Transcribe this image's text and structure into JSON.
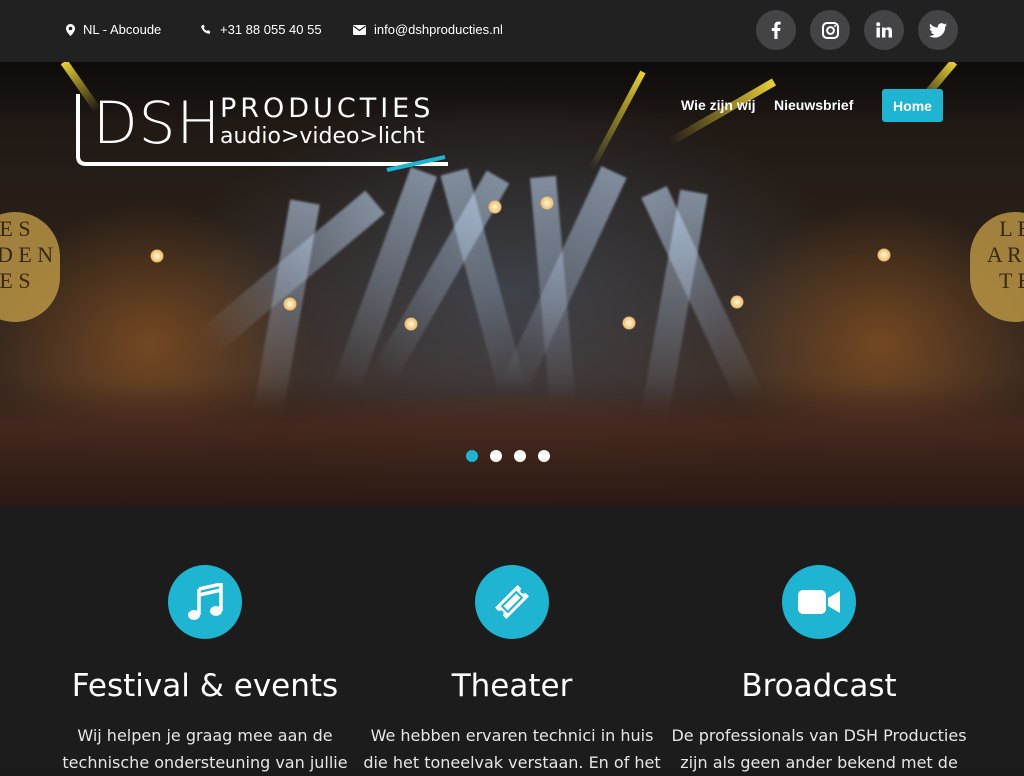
{
  "topbar": {
    "location": "NL - Abcoude",
    "phone": "+31 88 055 40 55",
    "email": "info@dshproducties.nl",
    "social": [
      "facebook-icon",
      "instagram-icon",
      "linkedin-icon",
      "twitter-icon"
    ]
  },
  "logo": {
    "main": "DSH",
    "word": "PRODUCTIES",
    "sub": "audio>video>licht"
  },
  "nav": {
    "items": [
      "Wie zijn wij",
      "Nieuwsbrief",
      "Home"
    ],
    "active": "Home"
  },
  "hero": {
    "slides": 4,
    "active_slide": 1,
    "banner_left": [
      "E S",
      "R D E N",
      "E S"
    ],
    "banner_right": [
      "L E",
      "A R D",
      "T E"
    ]
  },
  "features": [
    {
      "icon": "music-note-icon",
      "title": "Festival & events",
      "text_lines": [
        "Wij helpen je graag mee aan de",
        "technische ondersteuning van jullie"
      ]
    },
    {
      "icon": "ticket-icon",
      "title": "Theater",
      "text_lines": [
        "We hebben ervaren technici in huis",
        "die het toneelvak verstaan. En of het"
      ]
    },
    {
      "icon": "video-camera-icon",
      "title": "Broadcast",
      "text_lines": [
        "De professionals van DSH Producties",
        "zijn als geen ander bekend met de"
      ]
    }
  ],
  "colors": {
    "accent": "#1fb4d2",
    "topbar": "#212121",
    "social_bg": "#444446",
    "section_bg": "#1c1c1c"
  }
}
